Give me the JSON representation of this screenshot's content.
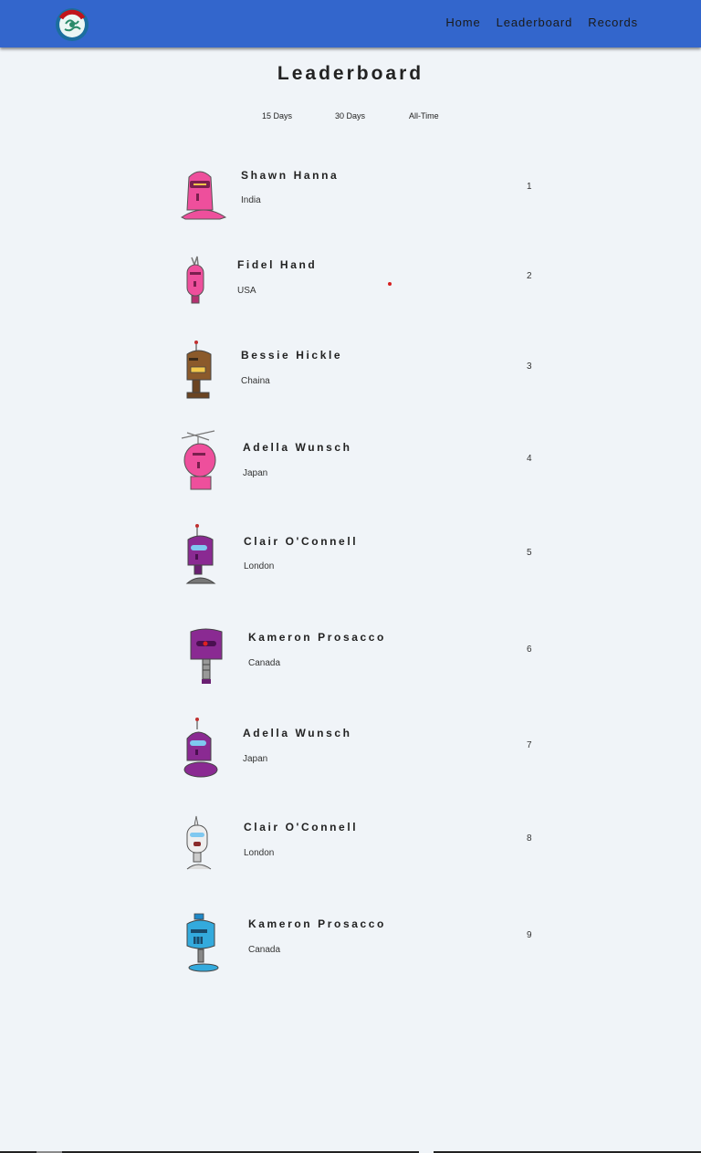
{
  "nav": {
    "home": "Home",
    "leaderboard": "Leaderboard",
    "records": "Records"
  },
  "page": {
    "title": "Leaderboard"
  },
  "filters": [
    "15 Days",
    "30 Days",
    "All-Time"
  ],
  "colors": {
    "navbar": "#3366cc",
    "background": "#f0f4f8",
    "pink": "#ee4f9c",
    "purple": "#8a2a92",
    "brown": "#8b5a2b",
    "white": "#eeeeee",
    "blue": "#33aadd"
  },
  "leaders": [
    {
      "name": "Shawn Hanna",
      "country": "India",
      "rank": "1",
      "avatar": "pink-knight-robot-icon"
    },
    {
      "name": "Fidel Hand",
      "country": "USA",
      "rank": "2",
      "avatar": "pink-mohawk-robot-icon"
    },
    {
      "name": "Bessie Hickle",
      "country": "Chaina",
      "rank": "3",
      "avatar": "brown-antenna-robot-icon"
    },
    {
      "name": "Adella Wunsch",
      "country": "Japan",
      "rank": "4",
      "avatar": "pink-tv-antenna-robot-icon"
    },
    {
      "name": "Clair O'Connell",
      "country": "London",
      "rank": "5",
      "avatar": "purple-visor-robot-icon"
    },
    {
      "name": "Kameron Prosacco",
      "country": "Canada",
      "rank": "6",
      "avatar": "purple-cyclops-robot-icon"
    },
    {
      "name": "Adella Wunsch",
      "country": "Japan",
      "rank": "7",
      "avatar": "purple-dome-robot-icon"
    },
    {
      "name": "Clair O'Connell",
      "country": "London",
      "rank": "8",
      "avatar": "white-horn-robot-icon"
    },
    {
      "name": "Kameron Prosacco",
      "country": "Canada",
      "rank": "9",
      "avatar": "blue-grille-robot-icon"
    }
  ]
}
